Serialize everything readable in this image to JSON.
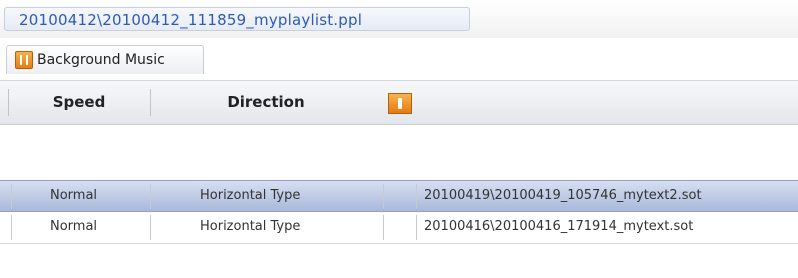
{
  "window": {
    "title": "20100412\\20100412_111859_myplaylist.ppl"
  },
  "tabs": [
    {
      "label": "Background Music",
      "icon": "music-icon"
    }
  ],
  "toolbar": {
    "speed_label": "Speed",
    "direction_label": "Direction",
    "toggle_icon": "orange-toggle-icon"
  },
  "rows": [
    {
      "speed": "Normal",
      "direction": "Horizontal Type",
      "file": "20100419\\20100419_105746_mytext2.sot",
      "selected": true
    },
    {
      "speed": "Normal",
      "direction": "Horizontal Type",
      "file": "20100416\\20100416_171914_mytext.sot",
      "selected": false
    }
  ],
  "colors": {
    "accent": "#e67d12",
    "title_text": "#2e5bb0",
    "selection": "#a9b9db"
  }
}
